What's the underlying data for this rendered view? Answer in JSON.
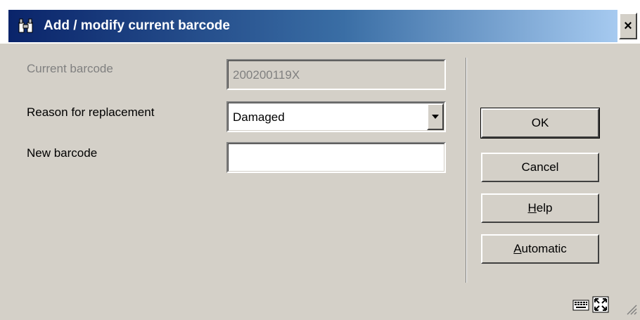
{
  "window": {
    "title": "Add / modify current barcode",
    "close_label": "×",
    "title_icon": "binoculars-icon"
  },
  "form": {
    "current_barcode": {
      "label": "Current barcode",
      "value": "200200119X",
      "enabled": false
    },
    "reason": {
      "label": "Reason for replacement",
      "selected": "Damaged"
    },
    "new_barcode": {
      "label": "New barcode",
      "value": ""
    }
  },
  "buttons": {
    "ok": "OK",
    "cancel": "Cancel",
    "help_prefix": "",
    "help_mnemonic": "H",
    "help_rest": "elp",
    "auto_mnemonic": "A",
    "auto_rest": "utomatic"
  },
  "status_icons": [
    "keyboard-icon",
    "fullscreen-icon"
  ],
  "colors": {
    "dialog_bg": "#d4d0c8",
    "title_start": "#0a246a",
    "title_end": "#a6caf0",
    "disabled_text": "#808080"
  }
}
